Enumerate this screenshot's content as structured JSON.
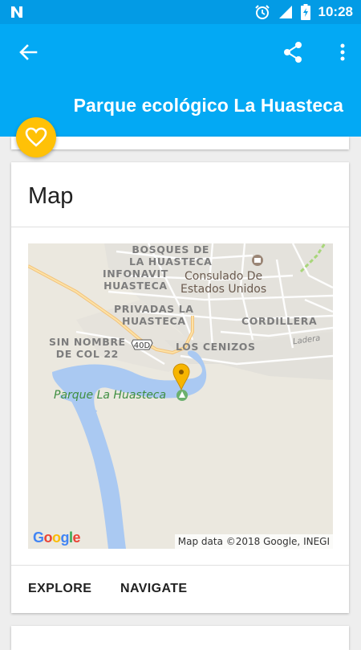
{
  "status_bar": {
    "time": "10:28",
    "icons": [
      "n-notification-icon",
      "alarm-icon",
      "signal-icon",
      "battery-charging-icon"
    ]
  },
  "app_bar": {
    "title": "Parque ecológico La Huasteca",
    "color": "#03a9f4",
    "status_color": "#039be5"
  },
  "fab": {
    "icon": "heart-outline-icon",
    "color": "#ffc107"
  },
  "map_card": {
    "title": "Map",
    "map": {
      "areas": {
        "bosques": "BOSQUES DE\nLA HUASTECA",
        "infonavit": "INFONAVIT\nHUASTECA",
        "privadas": "PRIVADAS LA\nHUASTECA",
        "sin_nombre": "SIN NOMBRE\nDE COL 22",
        "cenizos": "LOS CENIZOS",
        "cordillera": "CORDILLERA"
      },
      "poi": "Consulado De\nEstados Unidos",
      "park": "Parque La Huasteca",
      "street": "Ladera",
      "route": "40D",
      "google_logo": "Google",
      "attribution": "Map data ©2018 Google, INEGI"
    },
    "actions": {
      "explore": "EXPLORE",
      "navigate": "NAVIGATE"
    }
  }
}
